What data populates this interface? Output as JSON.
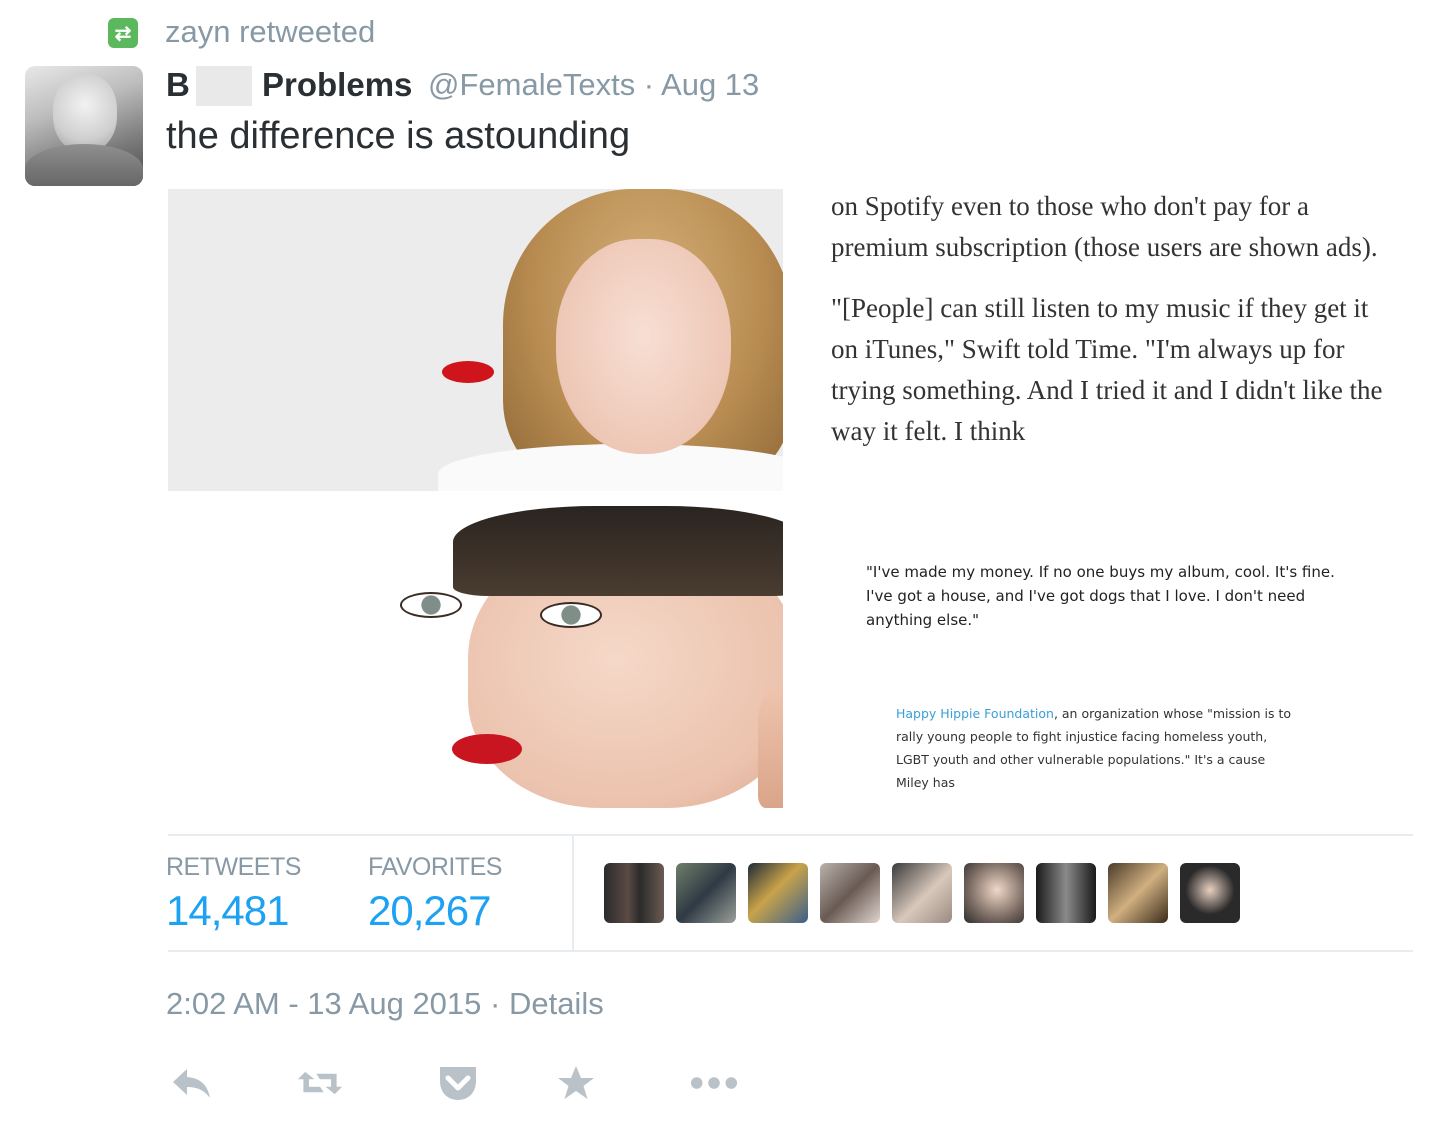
{
  "retweet_header": {
    "label": "zayn retweeted"
  },
  "tweet": {
    "author_initial": "B",
    "author_name_rest": "Problems",
    "handle_time": "@FemaleTexts · Aug 13",
    "text": "the difference is astounding"
  },
  "media": {
    "article_paragraph_1": "on Spotify even to those who don't pay for a premium subscription (those users are shown ads).",
    "article_paragraph_2": "\"[People] can still listen to my music if they get it on iTunes,\" Swift told Time. \"I'm always up for trying something. And I tried it and I didn't like the way it felt. I think",
    "quote": "\"I've made my money. If no one buys my album, cool. It's fine. I've got a house, and I've got dogs that I love. I don't need anything else.\"",
    "foundation_link": "Happy Hippie Foundation",
    "foundation_text": ", an organization whose \"mission is to rally young people to fight injustice facing homeless youth, LGBT youth and other vulnerable populations.\" It's a cause Miley has"
  },
  "stats": {
    "retweets_label": "RETWEETS",
    "retweets_value": "14,481",
    "favorites_label": "FAVORITES",
    "favorites_value": "20,267"
  },
  "timestamp": "2:02 AM - 13 Aug 2015 · Details",
  "actions": [
    "reply",
    "retweet",
    "pocket",
    "favorite",
    "more"
  ],
  "colors": {
    "accent": "#1da1f2",
    "muted": "#8899a6",
    "retweet_green": "#5cb85c"
  }
}
